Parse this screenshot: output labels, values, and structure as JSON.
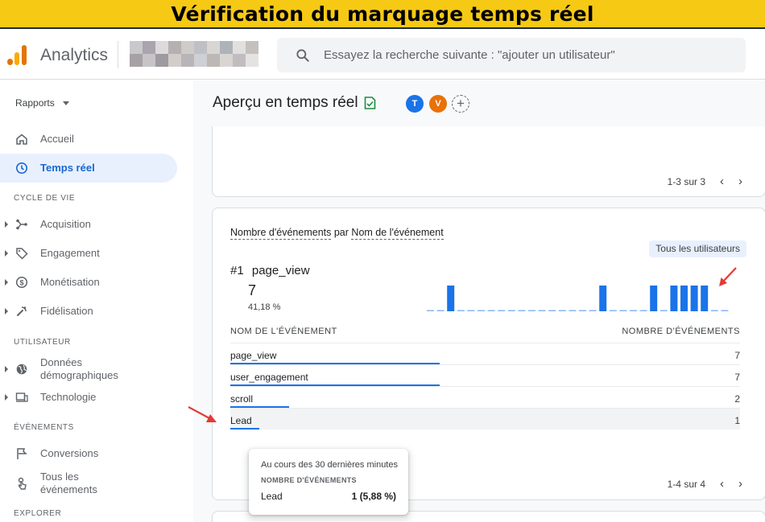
{
  "banner": {
    "title": "Vérification du marquage temps réel"
  },
  "topbar": {
    "app_name": "Analytics",
    "search_placeholder": "Essayez la recherche suivante : \"ajouter un utilisateur\""
  },
  "sidebar": {
    "rapports_label": "Rapports",
    "items": [
      {
        "label": "Accueil",
        "icon": "home-icon"
      },
      {
        "label": "Temps réel",
        "icon": "clock-icon",
        "active": true
      }
    ],
    "section_cycle": "CYCLE DE VIE",
    "cycle_items": [
      {
        "label": "Acquisition",
        "icon": "acquisition-icon"
      },
      {
        "label": "Engagement",
        "icon": "tag-icon"
      },
      {
        "label": "Monétisation",
        "icon": "dollar-icon"
      },
      {
        "label": "Fidélisation",
        "icon": "retention-icon"
      }
    ],
    "section_user": "UTILISATEUR",
    "user_items": [
      {
        "label": "Données démographiques",
        "icon": "globe-icon"
      },
      {
        "label": "Technologie",
        "icon": "devices-icon"
      }
    ],
    "section_events": "ÉVÉNEMENTS",
    "event_items": [
      {
        "label": "Conversions",
        "icon": "flag-icon"
      },
      {
        "label": "Tous les événements",
        "icon": "touch-icon"
      }
    ],
    "section_explore": "EXPLORER"
  },
  "main": {
    "page_title": "Aperçu en temps réel",
    "avatars": [
      {
        "letter": "T",
        "color": "#1a73e8"
      },
      {
        "letter": "V",
        "color": "#e8710a"
      }
    ],
    "card1": {
      "pager": "1-3 sur 3"
    },
    "card2": {
      "title_part1": "Nombre d'événements",
      "title_par": "par",
      "title_part2": "Nom de l'événement",
      "chip": "Tous les utilisateurs",
      "top_rank": "#1",
      "top_name": "page_view",
      "top_value": "7",
      "top_pct": "41,18 %",
      "col_name": "NOM DE L'ÉVÉNEMENT",
      "col_count": "NOMBRE D'ÉVÉNEMENTS",
      "rows": [
        {
          "name": "page_view",
          "value": "7",
          "share": 1.0
        },
        {
          "name": "user_engagement",
          "value": "7",
          "share": 1.0
        },
        {
          "name": "scroll",
          "value": "2",
          "share": 0.28
        },
        {
          "name": "Lead",
          "value": "1",
          "share": 0.14,
          "highlighted": true
        }
      ],
      "pager": "1-4 sur 4",
      "sparkline_per_minute": [
        0,
        0,
        1,
        0,
        0,
        0,
        0,
        0,
        0,
        0,
        0,
        0,
        0,
        0,
        0,
        0,
        0,
        1,
        0,
        0,
        0,
        0,
        1,
        0,
        1,
        1,
        1,
        1,
        0,
        0
      ]
    },
    "tooltip": {
      "heading": "Au cours des 30 dernières minutes",
      "metric": "NOMBRE D'ÉVÉNEMENTS",
      "row_name": "Lead",
      "row_value": "1 (5,88 %)"
    }
  },
  "colors": {
    "accent": "#1a73e8",
    "banner": "#f6c915",
    "annotation_arrow": "#e53935"
  }
}
